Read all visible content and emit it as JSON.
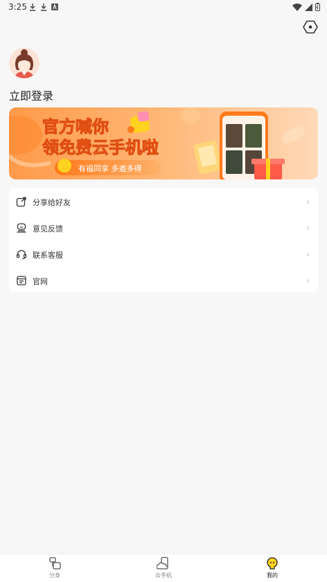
{
  "status_bar": {
    "time": "3:25"
  },
  "profile": {
    "login_label": "立即登录"
  },
  "banner": {
    "line1": "官方喊你",
    "line2": "领免费云手机啦",
    "tagline": "有福同享 多邀多得"
  },
  "menu": {
    "items": [
      {
        "label": "分享给好友",
        "icon": "share-icon"
      },
      {
        "label": "意见反馈",
        "icon": "feedback-icon"
      },
      {
        "label": "联系客服",
        "icon": "headset-icon"
      },
      {
        "label": "官网",
        "icon": "website-icon"
      }
    ]
  },
  "tabbar": {
    "tabs": [
      {
        "label": "分身",
        "icon": "clone-icon"
      },
      {
        "label": "云手机",
        "icon": "cloud-phone-icon"
      },
      {
        "label": "我的",
        "icon": "profile-icon",
        "active": true
      }
    ]
  },
  "colors": {
    "banner_orange": "#ff7a1a",
    "accent_yellow": "#ffd21f",
    "background": "#f7f7f7"
  }
}
